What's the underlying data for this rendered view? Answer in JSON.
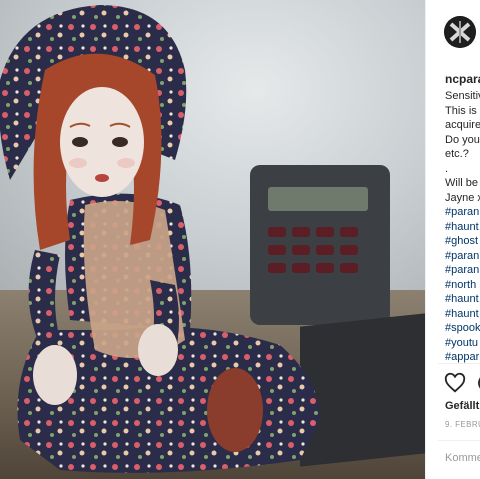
{
  "post": {
    "username": "ncpara",
    "caption_lines": [
      "Sensitiv",
      "This is",
      "acquire",
      "Do you",
      "etc.?",
      ".",
      "Will be",
      "Jayne x"
    ],
    "hashtags": [
      "#paran",
      "#haunt",
      "#ghost",
      "#paran",
      "#paran",
      "#north",
      "#haunt",
      "#haunt",
      "#spook",
      "#youtu",
      "#appar"
    ],
    "likes_label": "Gefällt",
    "date_label": "9. FEBRU",
    "comment_placeholder": "Komme"
  },
  "icons": {
    "avatar": "account-avatar-icon",
    "like": "heart-icon",
    "comment": "comment-icon"
  },
  "colors": {
    "text": "#262626",
    "hashtag": "#003569",
    "muted": "#999999"
  }
}
